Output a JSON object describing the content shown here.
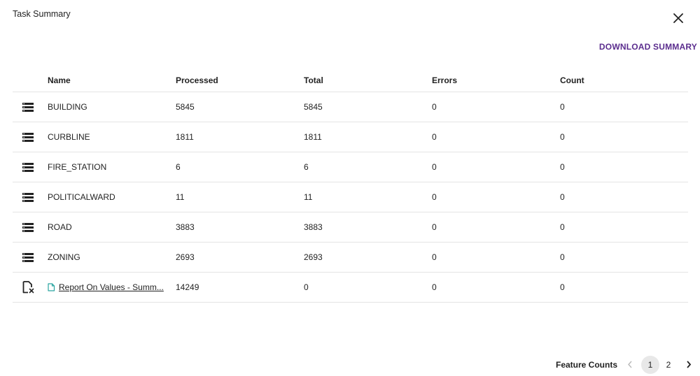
{
  "dialog": {
    "title": "Task Summary",
    "download_label": "DOWNLOAD SUMMARY"
  },
  "table": {
    "headers": [
      "Name",
      "Processed",
      "Total",
      "Errors",
      "Count"
    ],
    "rows": [
      {
        "icon": "list-icon",
        "name": "BUILDING",
        "processed": "5845",
        "total": "5845",
        "errors": "0",
        "count": "0"
      },
      {
        "icon": "list-icon",
        "name": "CURBLINE",
        "processed": "1811",
        "total": "1811",
        "errors": "0",
        "count": "0"
      },
      {
        "icon": "list-icon",
        "name": "FIRE_STATION",
        "processed": "6",
        "total": "6",
        "errors": "0",
        "count": "0"
      },
      {
        "icon": "list-icon",
        "name": "POLITICALWARD",
        "processed": "11",
        "total": "11",
        "errors": "0",
        "count": "0"
      },
      {
        "icon": "list-icon",
        "name": "ROAD",
        "processed": "3883",
        "total": "3883",
        "errors": "0",
        "count": "0"
      },
      {
        "icon": "list-icon",
        "name": "ZONING",
        "processed": "2693",
        "total": "2693",
        "errors": "0",
        "count": "0"
      },
      {
        "icon": "report-file-icon",
        "name": "Report On Values - Summ...",
        "processed": "14249",
        "total": "0",
        "errors": "0",
        "count": "0"
      }
    ]
  },
  "footer": {
    "label": "Feature Counts",
    "pages": [
      "1",
      "2"
    ],
    "current_page": "1"
  },
  "colors": {
    "accent": "#5b2d8e",
    "link_icon": "#2aa5a0",
    "divider": "#e4e4e4"
  }
}
